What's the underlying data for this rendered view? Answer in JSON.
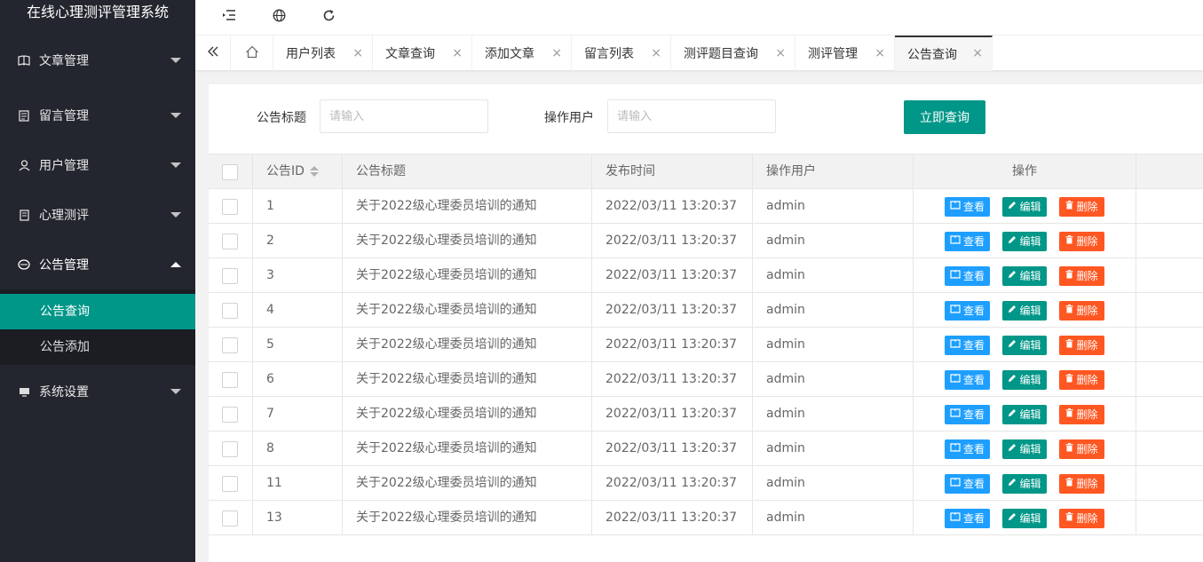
{
  "app": {
    "title": "在线心理测评管理系统"
  },
  "colors": {
    "sidebar_bg": "#23262e",
    "accent": "#009688",
    "view_btn": "#1e9fff",
    "delete_btn": "#ff5722"
  },
  "sidebar": {
    "items": [
      {
        "label": "文章管理",
        "icon": "book-icon"
      },
      {
        "label": "留言管理",
        "icon": "message-icon"
      },
      {
        "label": "用户管理",
        "icon": "user-icon"
      },
      {
        "label": "心理测评",
        "icon": "survey-icon"
      },
      {
        "label": "公告管理",
        "icon": "announcement-icon",
        "expanded": true,
        "children": [
          {
            "label": "公告查询",
            "active": true
          },
          {
            "label": "公告添加"
          }
        ]
      },
      {
        "label": "系统设置",
        "icon": "settings-icon"
      }
    ]
  },
  "header": {
    "icons": [
      "collapse-menu-icon",
      "globe-icon",
      "refresh-icon"
    ]
  },
  "tabs": {
    "items": [
      "用户列表",
      "文章查询",
      "添加文章",
      "留言列表",
      "测评题目查询",
      "测评管理",
      "公告查询"
    ],
    "active": "公告查询"
  },
  "search": {
    "title_label": "公告标题",
    "title_placeholder": "请输入",
    "user_label": "操作用户",
    "user_placeholder": "请输入",
    "button": "立即查询"
  },
  "table": {
    "columns": [
      "公告ID",
      "公告标题",
      "发布时间",
      "操作用户",
      "操作"
    ],
    "actions": {
      "view": "查看",
      "edit": "编辑",
      "delete": "删除"
    },
    "rows": [
      {
        "id": "1",
        "title": "关于2022级心理委员培训的通知",
        "time": "2022/03/11 13:20:37",
        "user": "admin"
      },
      {
        "id": "2",
        "title": "关于2022级心理委员培训的通知",
        "time": "2022/03/11 13:20:37",
        "user": "admin"
      },
      {
        "id": "3",
        "title": "关于2022级心理委员培训的通知",
        "time": "2022/03/11 13:20:37",
        "user": "admin"
      },
      {
        "id": "4",
        "title": "关于2022级心理委员培训的通知",
        "time": "2022/03/11 13:20:37",
        "user": "admin"
      },
      {
        "id": "5",
        "title": "关于2022级心理委员培训的通知",
        "time": "2022/03/11 13:20:37",
        "user": "admin"
      },
      {
        "id": "6",
        "title": "关于2022级心理委员培训的通知",
        "time": "2022/03/11 13:20:37",
        "user": "admin"
      },
      {
        "id": "7",
        "title": "关于2022级心理委员培训的通知",
        "time": "2022/03/11 13:20:37",
        "user": "admin"
      },
      {
        "id": "8",
        "title": "关于2022级心理委员培训的通知",
        "time": "2022/03/11 13:20:37",
        "user": "admin"
      },
      {
        "id": "11",
        "title": "关于2022级心理委员培训的通知",
        "time": "2022/03/11 13:20:37",
        "user": "admin"
      },
      {
        "id": "13",
        "title": "关于2022级心理委员培训的通知",
        "time": "2022/03/11 13:20:37",
        "user": "admin"
      }
    ]
  }
}
